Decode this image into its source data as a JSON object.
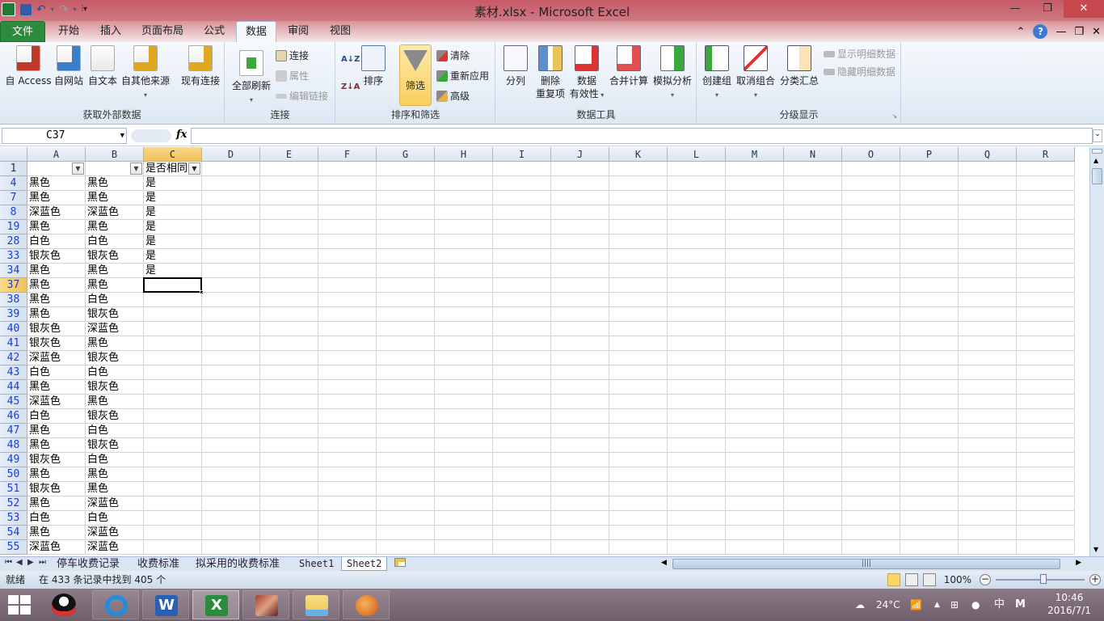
{
  "window": {
    "title": "素材.xlsx - Microsoft Excel"
  },
  "qat": {
    "save": "save-icon",
    "undo": "undo-icon",
    "redo": "redo-icon",
    "customize": "customize-icon"
  },
  "window_controls": {
    "minimize": "—",
    "restore": "❐",
    "close": "✕"
  },
  "tabs": [
    {
      "label": "文件"
    },
    {
      "label": "开始"
    },
    {
      "label": "插入"
    },
    {
      "label": "页面布局"
    },
    {
      "label": "公式"
    },
    {
      "label": "数据"
    },
    {
      "label": "审阅"
    },
    {
      "label": "视图"
    }
  ],
  "tab_right": {
    "collapse": "⌃",
    "help": "?",
    "min": "—",
    "restore": "❐",
    "close": "✕"
  },
  "ribbon": {
    "get_external": {
      "label": "获取外部数据",
      "buttons": [
        "自 Access",
        "自网站",
        "自文本",
        "自其他来源",
        "现有连接"
      ]
    },
    "connections": {
      "label": "连接",
      "refresh_all": "全部刷新",
      "connections": "连接",
      "properties": "属性",
      "edit_links": "编辑链接"
    },
    "sort_filter": {
      "label": "排序和筛选",
      "sort": "排序",
      "filter": "筛选",
      "clear": "清除",
      "reapply": "重新应用",
      "advanced": "高级",
      "az": "A↓Z",
      "za": "Z↓A"
    },
    "data_tools": {
      "label": "数据工具",
      "text_to_columns": "分列",
      "remove_dup_1": "删除",
      "remove_dup_2": "重复项",
      "validation_1": "数据",
      "validation_2": "有效性",
      "consolidate": "合并计算",
      "whatif": "模拟分析"
    },
    "outline": {
      "label": "分级显示",
      "group": "创建组",
      "ungroup": "取消组合",
      "subtotal": "分类汇总",
      "show_detail": "显示明细数据",
      "hide_detail": "隐藏明细数据"
    }
  },
  "formula_bar": {
    "name_box": "C37",
    "fx": "fx",
    "formula": ""
  },
  "columns": [
    "A",
    "B",
    "C",
    "D",
    "E",
    "F",
    "G",
    "H",
    "I",
    "J",
    "K",
    "L",
    "M",
    "N",
    "O",
    "P",
    "Q",
    "R"
  ],
  "header_row": {
    "row": "1",
    "A": "",
    "B": "",
    "C": "是否相同"
  },
  "rows": [
    {
      "row": "4",
      "A": "黑色",
      "B": "黑色",
      "C": "是"
    },
    {
      "row": "7",
      "A": "黑色",
      "B": "黑色",
      "C": "是"
    },
    {
      "row": "8",
      "A": "深蓝色",
      "B": "深蓝色",
      "C": "是"
    },
    {
      "row": "19",
      "A": "黑色",
      "B": "黑色",
      "C": "是"
    },
    {
      "row": "28",
      "A": "白色",
      "B": "白色",
      "C": "是"
    },
    {
      "row": "33",
      "A": "银灰色",
      "B": "银灰色",
      "C": "是"
    },
    {
      "row": "34",
      "A": "黑色",
      "B": "黑色",
      "C": "是"
    },
    {
      "row": "37",
      "A": "黑色",
      "B": "黑色",
      "C": ""
    },
    {
      "row": "38",
      "A": "黑色",
      "B": "白色",
      "C": ""
    },
    {
      "row": "39",
      "A": "黑色",
      "B": "银灰色",
      "C": ""
    },
    {
      "row": "40",
      "A": "银灰色",
      "B": "深蓝色",
      "C": ""
    },
    {
      "row": "41",
      "A": "银灰色",
      "B": "黑色",
      "C": ""
    },
    {
      "row": "42",
      "A": "深蓝色",
      "B": "银灰色",
      "C": ""
    },
    {
      "row": "43",
      "A": "白色",
      "B": "白色",
      "C": ""
    },
    {
      "row": "44",
      "A": "黑色",
      "B": "银灰色",
      "C": ""
    },
    {
      "row": "45",
      "A": "深蓝色",
      "B": "黑色",
      "C": ""
    },
    {
      "row": "46",
      "A": "白色",
      "B": "银灰色",
      "C": ""
    },
    {
      "row": "47",
      "A": "黑色",
      "B": "白色",
      "C": ""
    },
    {
      "row": "48",
      "A": "黑色",
      "B": "银灰色",
      "C": ""
    },
    {
      "row": "49",
      "A": "银灰色",
      "B": "白色",
      "C": ""
    },
    {
      "row": "50",
      "A": "黑色",
      "B": "黑色",
      "C": ""
    },
    {
      "row": "51",
      "A": "银灰色",
      "B": "黑色",
      "C": ""
    },
    {
      "row": "52",
      "A": "黑色",
      "B": "深蓝色",
      "C": ""
    },
    {
      "row": "53",
      "A": "白色",
      "B": "白色",
      "C": ""
    },
    {
      "row": "54",
      "A": "黑色",
      "B": "深蓝色",
      "C": ""
    },
    {
      "row": "55",
      "A": "深蓝色",
      "B": "深蓝色",
      "C": ""
    }
  ],
  "active_cell": {
    "col": "C",
    "row": "37"
  },
  "sheets": [
    {
      "label": "停车收费记录",
      "active": false
    },
    {
      "label": "收费标准",
      "active": false
    },
    {
      "label": "拟采用的收费标准",
      "active": false
    },
    {
      "label": "Sheet1",
      "active": false
    },
    {
      "label": "Sheet2",
      "active": true
    }
  ],
  "status": {
    "ready": "就绪",
    "message": "在 433 条记录中找到 405 个",
    "zoom": "100%"
  },
  "taskbar": {
    "apps": [
      "start-icon",
      "qq-icon",
      "browser-icon",
      "word-icon",
      "excel-icon",
      "photo-icon",
      "explorer-icon",
      "app-icon"
    ],
    "weather": "24°C",
    "ime": "中",
    "ime2": "M",
    "time": "10:46",
    "date": "2016/7/1"
  },
  "colors": {
    "title_bar": "#c65a66",
    "file_tab": "#2c8c3b",
    "selected_header": "#f1c15b",
    "row_number": "#1a3ecc"
  }
}
